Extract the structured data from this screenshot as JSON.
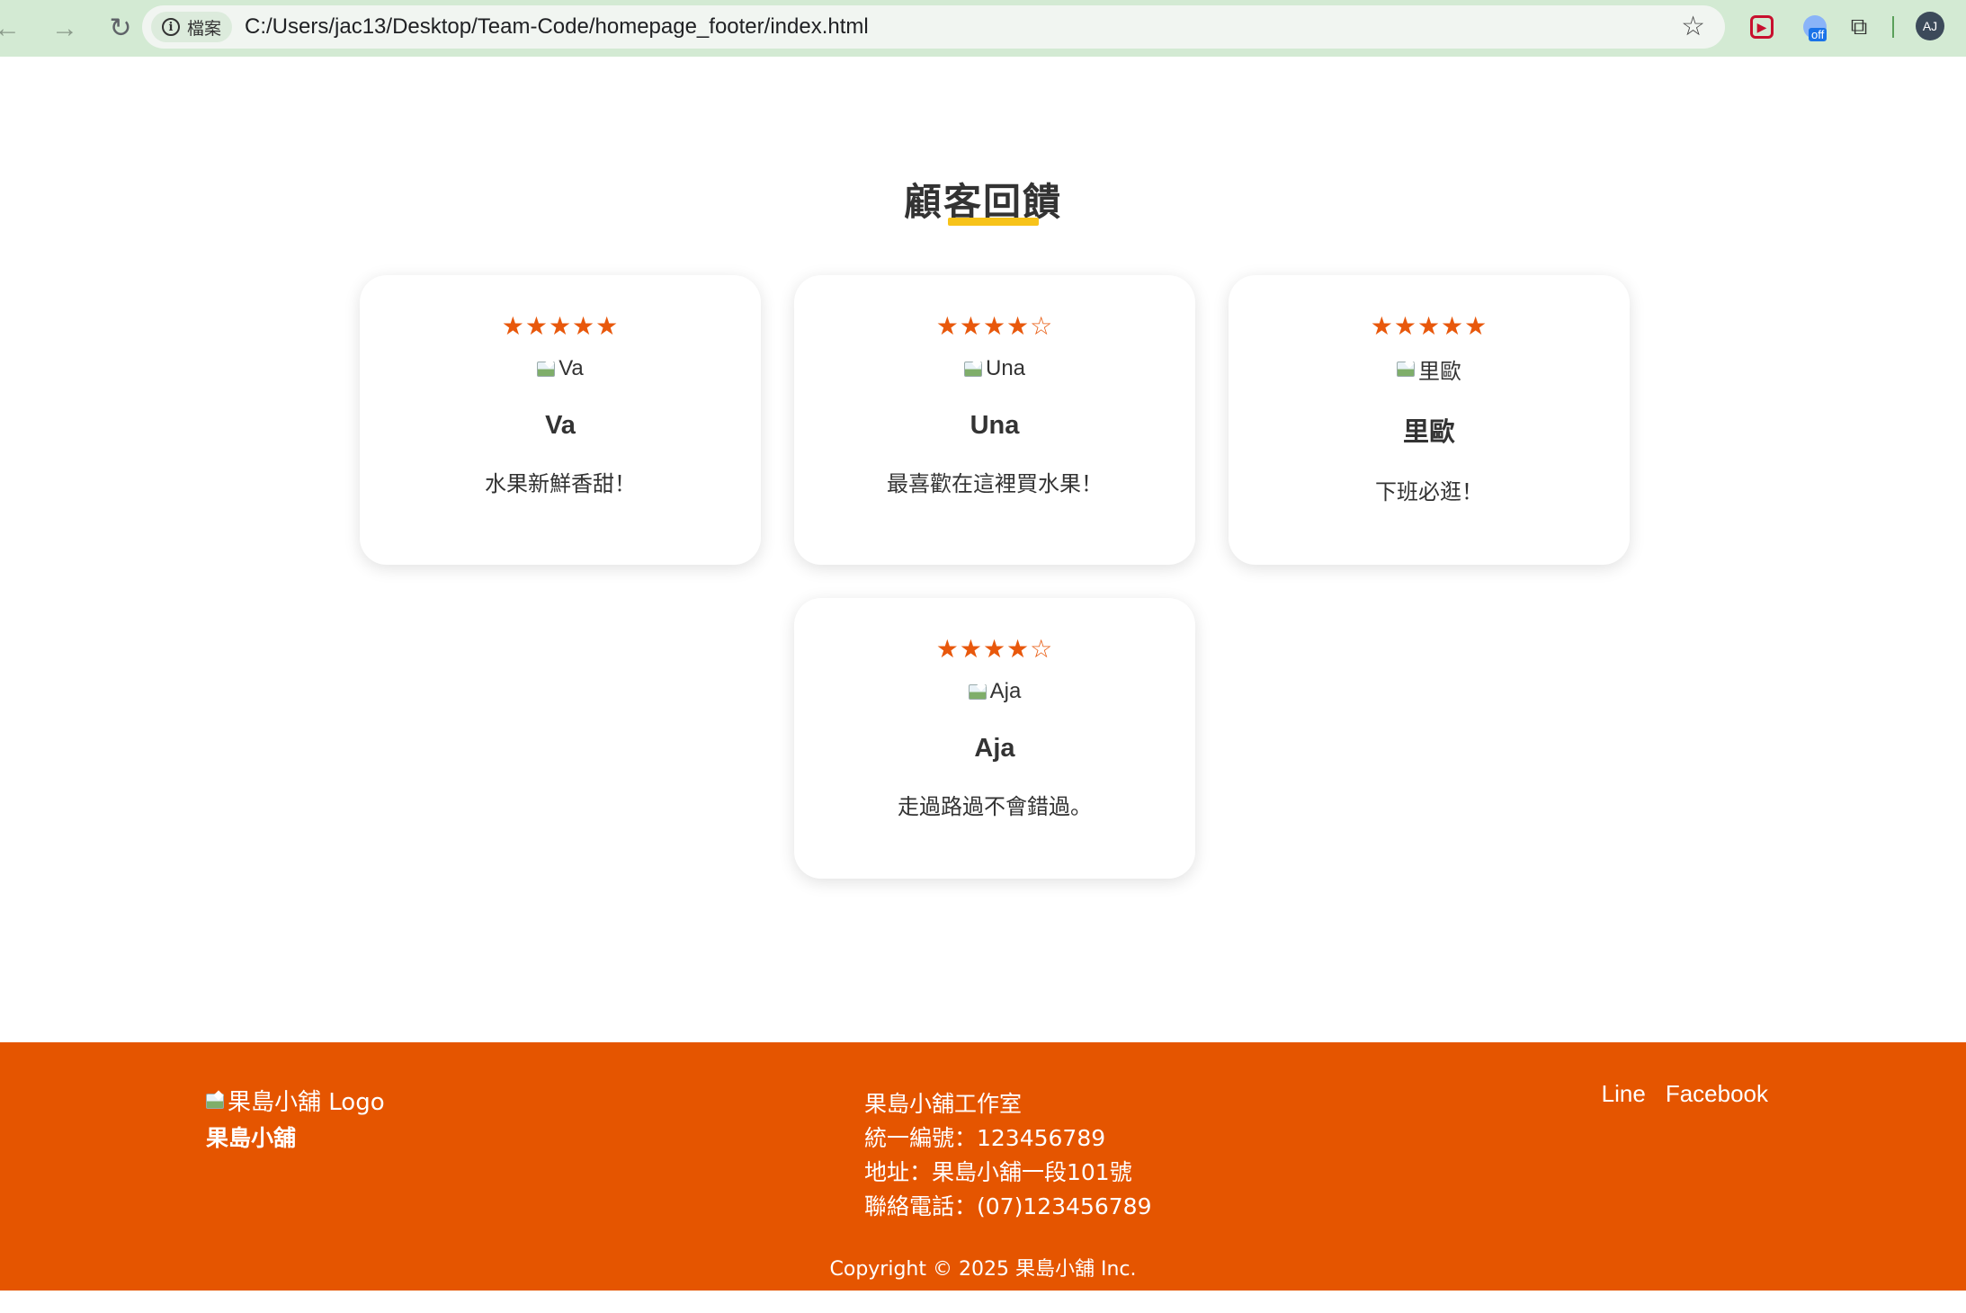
{
  "browser": {
    "site_chip": "檔案",
    "url": "C:/Users/jac13/Desktop/Team-Code/homepage_footer/index.html",
    "extension_badge": "off",
    "profile_initials": "AJ"
  },
  "section": {
    "title": "顧客回饋"
  },
  "reviews": [
    {
      "stars": "★★★★★",
      "rating": 5,
      "image_alt": "Va",
      "name": "Va",
      "quote": "水果新鮮香甜！"
    },
    {
      "stars": "★★★★☆",
      "rating": 4,
      "image_alt": "Una",
      "name": "Una",
      "quote": "最喜歡在這裡買水果！"
    },
    {
      "stars": "★★★★★",
      "rating": 5,
      "image_alt": "里歐",
      "name": "里歐",
      "quote": "下班必逛！"
    },
    {
      "stars": "★★★★☆",
      "rating": 4,
      "image_alt": "Aja",
      "name": "Aja",
      "quote": "走過路過不會錯過。"
    }
  ],
  "footer": {
    "logo_alt": "果島小舖 Logo",
    "brand": "果島小舖",
    "info": [
      "果島小舖工作室",
      "統一編號：123456789",
      "地址：果島小舖一段101號",
      "聯絡電話：(07)123456789"
    ],
    "links": [
      "Line",
      "Facebook"
    ],
    "copyright": "Copyright © 2025 果島小舖 Inc."
  },
  "colors": {
    "accent_orange": "#e55500",
    "star_orange": "#e8580c",
    "underline_yellow": "#f7c31a",
    "chrome_green": "#d3ead3"
  }
}
